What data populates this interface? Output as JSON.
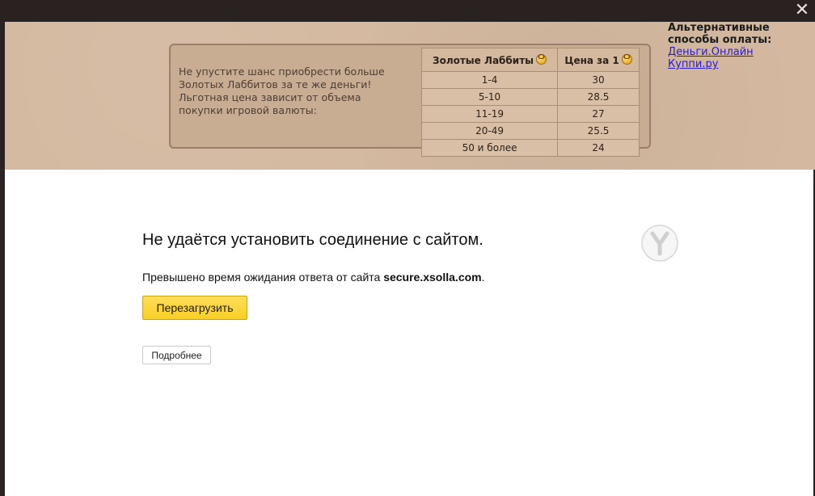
{
  "window": {
    "close_glyph": "✕"
  },
  "promo": {
    "text": "Не упустите шанс приобрести больше\nЗолотых Лаббитов за те же деньги!\nЛьготная цена зависит от объема\nпокупки игровой валюты:",
    "table": {
      "headers": [
        "Золотые Лаббиты",
        "Цена за 1"
      ],
      "rows": [
        [
          "1-4",
          "30"
        ],
        [
          "5-10",
          "28.5"
        ],
        [
          "11-19",
          "27"
        ],
        [
          "20-49",
          "25.5"
        ],
        [
          "50 и более",
          "24"
        ]
      ]
    }
  },
  "alt_payment": {
    "title": "Альтернативные\nспособы оплаты:",
    "links": [
      "Деньги.Онлайн",
      "Куппи.ру"
    ]
  },
  "error_page": {
    "title": "Не удаётся установить соединение с сайтом.",
    "desc_prefix": "Превышено время ожидания ответа от сайта ",
    "host": "secure.xsolla.com",
    "desc_suffix": ".",
    "reload_label": "Перезагрузить",
    "details_label": "Подробнее"
  },
  "colors": {
    "promo_bg": "#d4b9a0",
    "reload_button": "#f8cf24",
    "link": "#2a1ad6"
  }
}
